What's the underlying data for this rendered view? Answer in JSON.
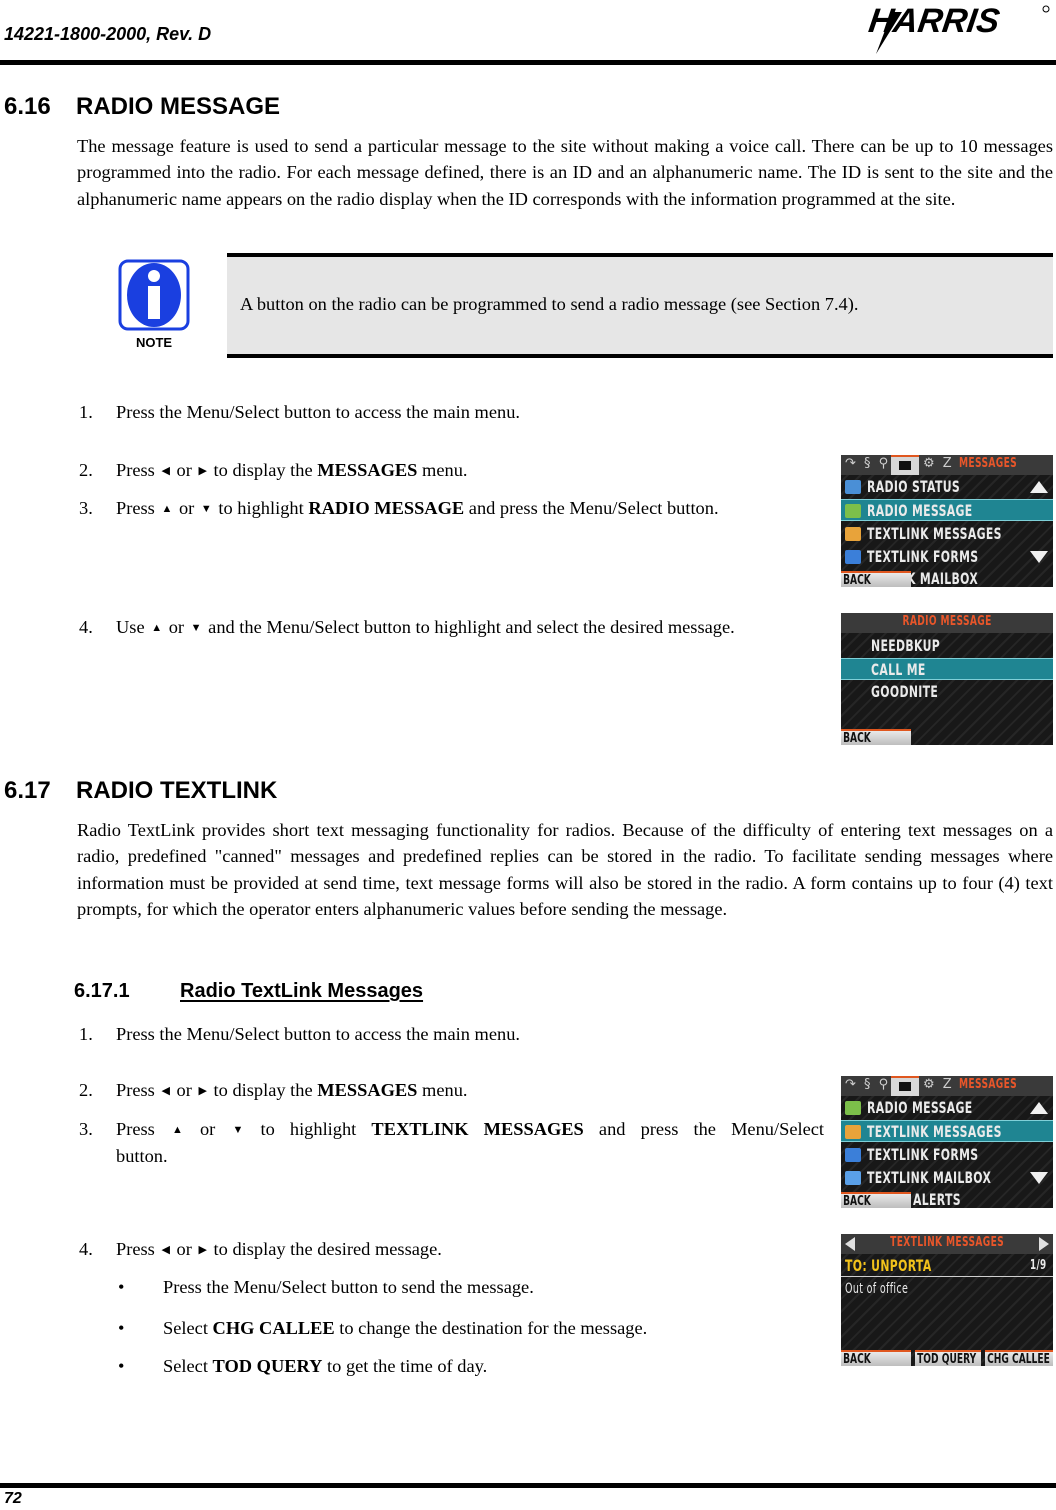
{
  "header": {
    "doc_number": "14221-1800-2000, Rev. D",
    "logo_text": "HARRIS"
  },
  "section_616": {
    "number": "6.16",
    "title": "RADIO MESSAGE",
    "body": "The message feature is used to send a particular message to the site without making a voice call. There can be up to 10 messages programmed into the radio. For each message defined, there is an ID and an alphanumeric name. The ID is sent to the site and the alphanumeric name appears on the radio display when the ID corresponds with the information programmed at the site.",
    "note": {
      "icon": "info-icon",
      "icon_label": "NOTE",
      "text": "A button on the radio can be programmed to send a radio message (see Section 7.4)."
    },
    "steps": [
      {
        "n": "1.",
        "pre": "Press the Menu/Select button to access the main menu.",
        "bold": "",
        "post": ""
      },
      {
        "n": "2.",
        "pre": "Press",
        "arrows": [
          "◀",
          "▶"
        ],
        "mid": "or",
        "pre2": "to display the",
        "bold": "MESSAGES",
        "post": "menu."
      },
      {
        "n": "3.",
        "pre": "Press",
        "arrows": [
          "▲",
          "▼"
        ],
        "mid": "or",
        "pre2": "to highlight",
        "bold": "RADIO MESSAGE",
        "post": "and press the Menu/Select button."
      },
      {
        "n": "4.",
        "pre": "Use",
        "arrows": [
          "▲",
          "▼"
        ],
        "mid": "or",
        "pre2": "and the Menu/Select button to highlight and select the desired message.",
        "bold": "",
        "post": ""
      }
    ],
    "screen_messages": {
      "title": "MESSAGES",
      "items": [
        "RADIO STATUS",
        "RADIO MESSAGE",
        "TEXTLINK MESSAGES",
        "TEXTLINK FORMS"
      ],
      "selected": "RADIO MESSAGE",
      "partial_item": "K MAILBOX",
      "softkey_left": "BACK"
    },
    "screen_radio_message": {
      "title": "RADIO MESSAGE",
      "items": [
        "NEEDBKUP",
        "CALL ME",
        "GOODNITE"
      ],
      "selected": "CALL ME",
      "softkey_left": "BACK"
    }
  },
  "section_617": {
    "number": "6.17",
    "title": "RADIO TEXTLINK",
    "body": "Radio TextLink provides short text messaging functionality for radios. Because of the difficulty of entering text messages on a radio, predefined \"canned\" messages and predefined replies can be stored in the radio. To facilitate sending messages where information must be provided at send time, text message forms will also be stored in the radio. A form contains up to four (4) text prompts, for which the operator enters alphanumeric values before sending the message.",
    "subsection": {
      "number": "6.17.1",
      "title": "Radio TextLink Messages",
      "steps": [
        {
          "n": "1.",
          "pre": "Press the Menu/Select button to access the main menu."
        },
        {
          "n": "2.",
          "pre": "Press",
          "arrows": [
            "◀",
            "▶"
          ],
          "mid": "or",
          "pre2": "to display the",
          "bold": "MESSAGES",
          "post": "menu."
        },
        {
          "n": "3.",
          "pre": "Press",
          "arrows": [
            "▲",
            "▼"
          ],
          "mid": "or",
          "pre2": "to highlight",
          "bold": "TEXTLINK MESSAGES",
          "post": "and press the Menu/Select button."
        },
        {
          "n": "4.",
          "pre": "Press",
          "arrows": [
            "◀",
            "▶"
          ],
          "mid": "or",
          "pre2": "to display the desired message."
        }
      ],
      "bullets": [
        {
          "pre": "Press the Menu/Select button to send the message.",
          "bold": "",
          "post": ""
        },
        {
          "pre": "Select",
          "bold": "CHG CALLEE",
          "post": "to change the destination for the message."
        },
        {
          "pre": "Select",
          "bold": "TOD QUERY",
          "post": "to get the time of day."
        }
      ],
      "screen_messages": {
        "title": "MESSAGES",
        "items": [
          "RADIO MESSAGE",
          "TEXTLINK MESSAGES",
          "TEXTLINK FORMS",
          "TEXTLINK MAILBOX"
        ],
        "selected": "TEXTLINK MESSAGES",
        "partial_item": "ALERTS",
        "softkey_left": "BACK"
      },
      "screen_textlink": {
        "title": "TEXTLINK MESSAGES",
        "to_label": "TO:  UNPORTA",
        "counter": "1/9",
        "message": "Out of office",
        "softkeys": [
          "BACK",
          "TOD QUERY",
          "CHG CALLEE"
        ]
      }
    }
  },
  "footer": {
    "page_number": "72"
  },
  "colors": {
    "highlight": "#1f8592",
    "title_orange": "#e8562a",
    "note_blue": "#1a3fe0",
    "note_bg": "#e6e6e6",
    "yellow_text": "#f2c21b"
  }
}
